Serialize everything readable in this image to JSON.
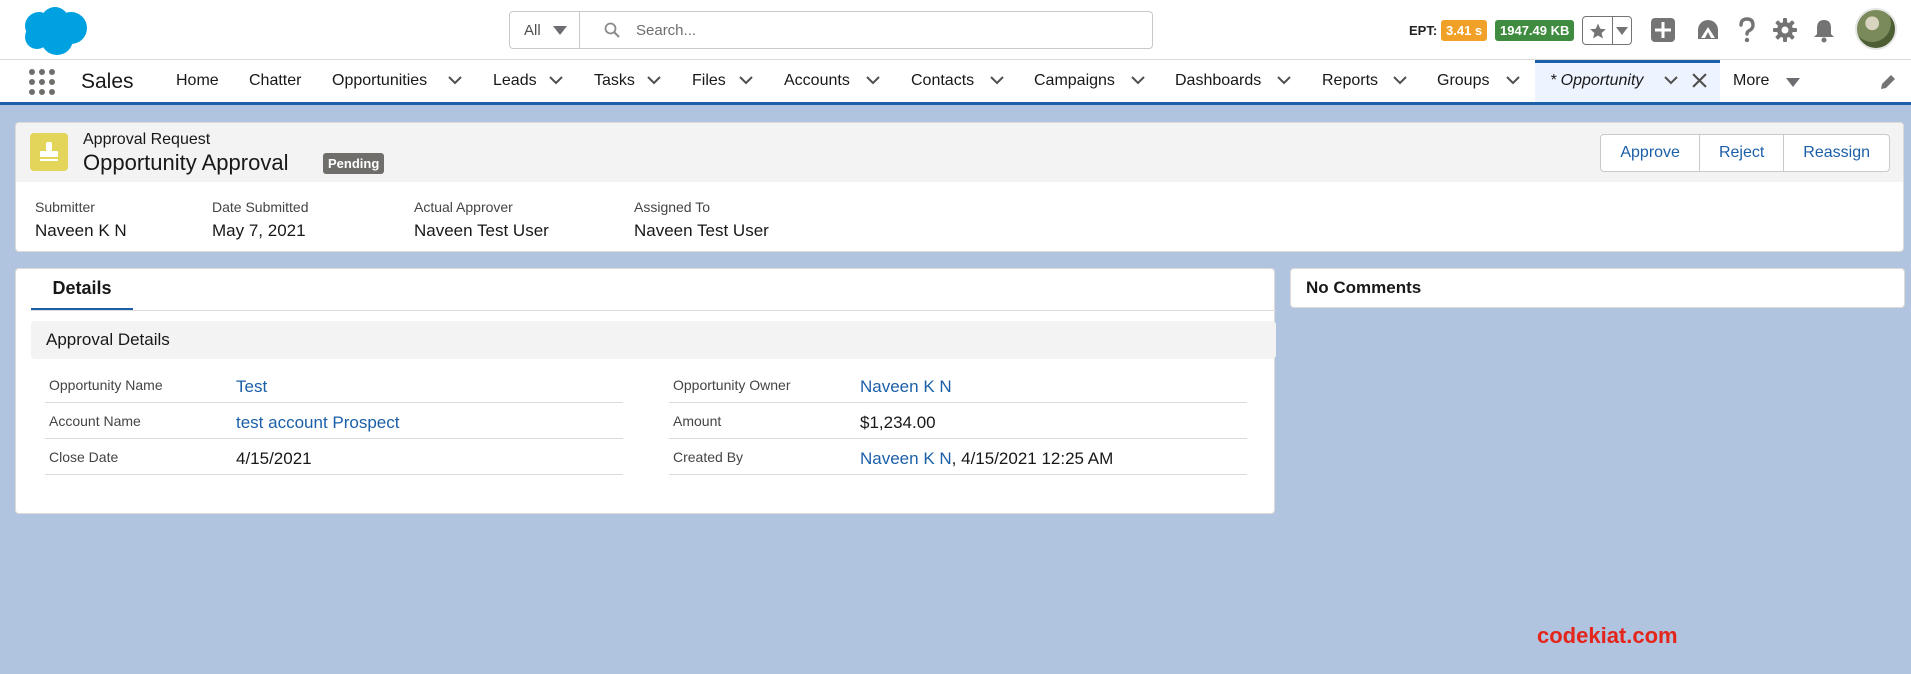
{
  "header": {
    "search": {
      "scope": "All",
      "placeholder": "Search..."
    },
    "ept": {
      "label": "EPT:",
      "time": "3.41 s",
      "size": "1947.49 KB"
    },
    "icons": [
      "salesforce-logo",
      "star-icon",
      "add-icon",
      "trailhead-icon",
      "help-icon",
      "setup-gear-icon",
      "notifications-bell-icon",
      "user-avatar"
    ]
  },
  "nav": {
    "app_name": "Sales",
    "items": [
      {
        "label": "Home"
      },
      {
        "label": "Chatter"
      },
      {
        "label": "Opportunities"
      },
      {
        "label": "Leads"
      },
      {
        "label": "Tasks"
      },
      {
        "label": "Files"
      },
      {
        "label": "Accounts"
      },
      {
        "label": "Contacts"
      },
      {
        "label": "Campaigns"
      },
      {
        "label": "Dashboards"
      },
      {
        "label": "Reports"
      },
      {
        "label": "Groups"
      }
    ],
    "active_tab": "* Opportunity",
    "more": "More"
  },
  "record": {
    "type": "Approval Request",
    "title": "Opportunity Approval",
    "status": "Pending",
    "actions": [
      "Approve",
      "Reject",
      "Reassign"
    ],
    "highlights": [
      {
        "label": "Submitter",
        "value": "Naveen K N"
      },
      {
        "label": "Date Submitted",
        "value": "May 7, 2021"
      },
      {
        "label": "Actual Approver",
        "value": "Naveen Test User"
      },
      {
        "label": "Assigned To",
        "value": "Naveen Test User"
      }
    ]
  },
  "details": {
    "tab": "Details",
    "section": "Approval Details",
    "left": [
      {
        "label": "Opportunity Name",
        "value": "Test"
      },
      {
        "label": "Account Name",
        "value": "test account Prospect"
      },
      {
        "label": "Close Date",
        "value": "4/15/2021"
      }
    ],
    "right": [
      {
        "label": "Opportunity Owner",
        "value": "Naveen K N"
      },
      {
        "label": "Amount",
        "value": "$1,234.00"
      },
      {
        "label": "Created By",
        "value": "Naveen K N",
        "suffix": ", 4/15/2021 12:25 AM"
      }
    ]
  },
  "comments": {
    "title": "No Comments"
  },
  "watermark": "codekiat.com",
  "colors": {
    "brand_blue": "#1b5fa8",
    "page_bg": "#b0c4df",
    "badge_orange": "#f2a128",
    "badge_green": "#3f8b3f",
    "stamp_icon": "#e3d559",
    "watermark_red": "#e4251b"
  }
}
